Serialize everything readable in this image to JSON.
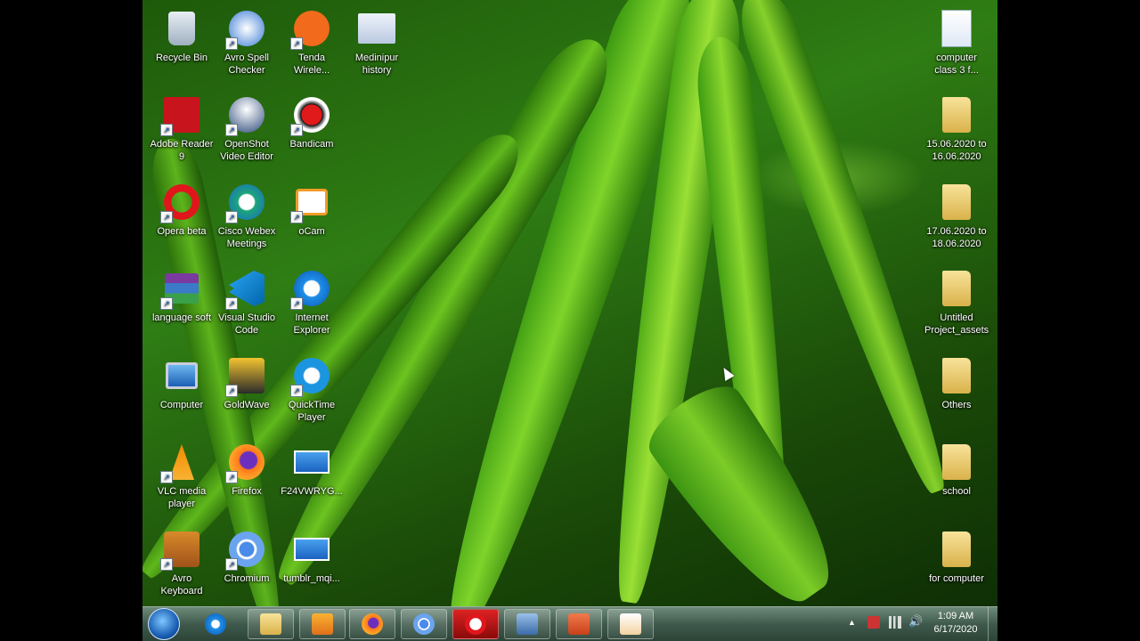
{
  "desktop": {
    "icons": [
      {
        "label": "Recycle Bin",
        "icon": "recycle-bin-icon"
      },
      {
        "label": "Avro Spell Checker",
        "icon": "avro-spell-checker-icon"
      },
      {
        "label": "Tenda Wirele...",
        "icon": "tenda-wireless-icon"
      },
      {
        "label": "Medinipur history",
        "icon": "powerpoint-file-icon"
      },
      {
        "label": "Adobe Reader 9",
        "icon": "adobe-reader-icon"
      },
      {
        "label": "OpenShot Video Editor",
        "icon": "openshot-icon"
      },
      {
        "label": "Bandicam",
        "icon": "bandicam-icon"
      },
      {
        "label": "Opera beta",
        "icon": "opera-icon"
      },
      {
        "label": "Cisco Webex Meetings",
        "icon": "webex-icon"
      },
      {
        "label": "oCam",
        "icon": "ocam-icon"
      },
      {
        "label": "language soft",
        "icon": "winrar-icon"
      },
      {
        "label": "Visual Studio Code",
        "icon": "vscode-icon"
      },
      {
        "label": "Internet Explorer",
        "icon": "internet-explorer-icon"
      },
      {
        "label": "Computer",
        "icon": "computer-icon"
      },
      {
        "label": "GoldWave",
        "icon": "goldwave-icon"
      },
      {
        "label": "QuickTime Player",
        "icon": "quicktime-icon"
      },
      {
        "label": "VLC media player",
        "icon": "vlc-icon"
      },
      {
        "label": "Firefox",
        "icon": "firefox-icon"
      },
      {
        "label": "F24VWRYG...",
        "icon": "image-file-icon"
      },
      {
        "label": "Avro Keyboard",
        "icon": "avro-keyboard-icon"
      },
      {
        "label": "Chromium",
        "icon": "chromium-icon"
      },
      {
        "label": "tumblr_mqi...",
        "icon": "image-file-icon"
      },
      {
        "label": "computer class 3 f...",
        "icon": "word-document-icon"
      },
      {
        "label": "15.06.2020 to 16.06.2020",
        "icon": "folder-icon"
      },
      {
        "label": "17.06.2020 to 18.06.2020",
        "icon": "folder-icon"
      },
      {
        "label": "Untitled Project_assets",
        "icon": "folder-icon"
      },
      {
        "label": "Others",
        "icon": "folder-icon"
      },
      {
        "label": "school",
        "icon": "folder-icon"
      },
      {
        "label": "for computer",
        "icon": "folder-icon"
      }
    ]
  },
  "taskbar": {
    "pinned": [
      "internet-explorer-icon",
      "explorer-folder-icon",
      "media-player-icon",
      "firefox-icon",
      "chromium-icon",
      "opera-icon",
      "control-panel-icon",
      "powerpoint-icon",
      "ocam-icon"
    ],
    "clock": {
      "time": "1:09 AM",
      "date": "6/17/2020"
    },
    "tray": [
      "show-hidden-icons-icon",
      "action-center-flag-icon",
      "network-icon",
      "volume-icon"
    ]
  }
}
